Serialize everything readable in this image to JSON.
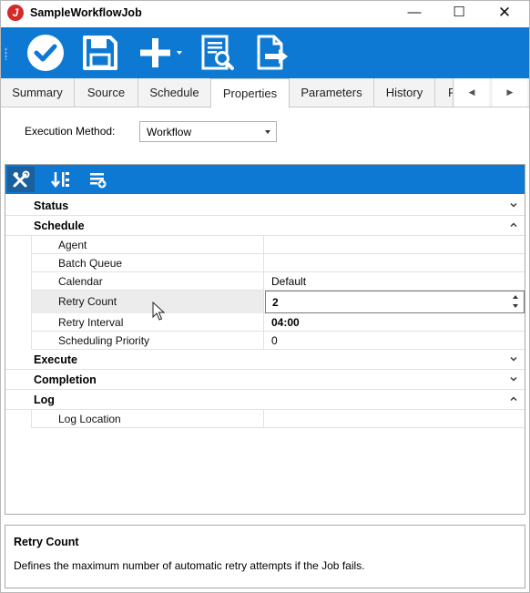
{
  "window": {
    "title": "SampleWorkflowJob",
    "app_icon_glyph": "J",
    "minimize": "—",
    "maximize": "☐",
    "close": "✕"
  },
  "toolbar": {
    "buttons": [
      {
        "icon": "check-circle-icon"
      },
      {
        "icon": "save-icon"
      },
      {
        "icon": "add-icon"
      },
      {
        "icon": "report-icon"
      },
      {
        "icon": "export-icon"
      }
    ]
  },
  "tabs": {
    "items": [
      "Summary",
      "Source",
      "Schedule",
      "Properties",
      "Parameters",
      "History",
      "R"
    ],
    "active": "Properties",
    "scroll_left": "◀",
    "scroll_right": "▶"
  },
  "execution": {
    "label": "Execution Method:",
    "value": "Workflow"
  },
  "grid": {
    "toolbar_icons": [
      "wrench-icon",
      "sort-icon",
      "add-list-icon"
    ],
    "categories": [
      {
        "label": "Status",
        "expanded": false
      },
      {
        "label": "Schedule",
        "expanded": true,
        "properties": [
          {
            "name": "Agent",
            "value": ""
          },
          {
            "name": "Batch Queue",
            "value": ""
          },
          {
            "name": "Calendar",
            "value": "Default"
          },
          {
            "name": "Retry Count",
            "value": "2"
          },
          {
            "name": "Retry Interval",
            "value": "04:00"
          },
          {
            "name": "Scheduling Priority",
            "value": "0"
          }
        ]
      },
      {
        "label": "Execute",
        "expanded": false
      },
      {
        "label": "Completion",
        "expanded": false
      },
      {
        "label": "Log",
        "expanded": true,
        "properties": [
          {
            "name": "Log Location",
            "value": ""
          }
        ]
      }
    ]
  },
  "description": {
    "title": "Retry Count",
    "text": "Defines the maximum number of automatic retry attempts if the Job fails."
  },
  "colors": {
    "accent": "#0d79d3",
    "selected_row": "#ececec"
  }
}
